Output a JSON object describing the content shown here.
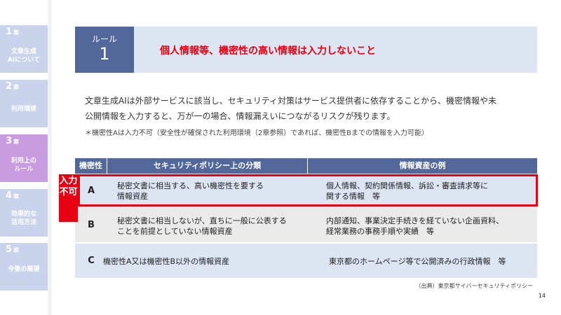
{
  "sidebar": {
    "chapters": [
      {
        "num": "1",
        "suffix": "章",
        "label_lines": [
          "文章生成",
          "AIについて"
        ],
        "active": false
      },
      {
        "num": "2",
        "suffix": "章",
        "label_lines": [
          "利用環境"
        ],
        "active": false
      },
      {
        "num": "3",
        "suffix": "章",
        "label_lines": [
          "利用上の",
          "ルール"
        ],
        "active": true
      },
      {
        "num": "4",
        "suffix": "章",
        "label_lines": [
          "効果的な",
          "活用方法"
        ],
        "active": false
      },
      {
        "num": "5",
        "suffix": "章",
        "label_lines": [
          "今後の展望"
        ],
        "active": false
      }
    ]
  },
  "header": {
    "rule_label": "ルール",
    "rule_number": "1",
    "title": "個人情報等、機密性の高い情報は入力しないこと"
  },
  "body": {
    "paragraph_line1": "文章生成AIは外部サービスに該当し、セキュリティ対策はサービス提供者に依存することから、機密情報や未",
    "paragraph_line2": "公開情報を入力すると、万が一の場合、情報漏えいにつながるリスクが残ります。",
    "note": "＊機密性Aは入力不可（安全性が確保された利用環境（2章参照）であれば、機密性Bまでの情報を入力可能）"
  },
  "table": {
    "headers": {
      "level": "機密性",
      "classification": "セキュリティポリシー上の分類",
      "example": "情報資産の例"
    },
    "rows": [
      {
        "level": "A",
        "classification_lines": [
          "秘密文書に相当する、高い機密性を要する",
          "情報資産"
        ],
        "example_lines": [
          "個人情報、契約関係情報、訴訟・審査請求等に",
          "関する情報　等"
        ]
      },
      {
        "level": "B",
        "classification_lines": [
          "秘密文書に相当しないが、直ちに一般に公表する",
          "ことを前提としていない情報資産"
        ],
        "example_lines": [
          "内部通知、事業決定手続きを経ていない企画資料、",
          "経常業務の事務手順や実績　等"
        ]
      },
      {
        "level": "C",
        "classification_lines": [
          "機密性A又は機密性B以外の情報資産"
        ],
        "example_lines": [
          "東京都のホームページ等で公開済みの行政情報　等"
        ]
      }
    ],
    "ban_label_lines": [
      "入力",
      "不可"
    ]
  },
  "footer": {
    "source": "（出典）東京都サイバーセキュリティポリシー",
    "page_number": "14"
  },
  "colors": {
    "accent_blue": "#53689a",
    "light_blue": "#dde5f3",
    "active_chapter": "#c99be0",
    "inactive_chapter": "#c9d4ec",
    "alert_red": "#e60012"
  }
}
